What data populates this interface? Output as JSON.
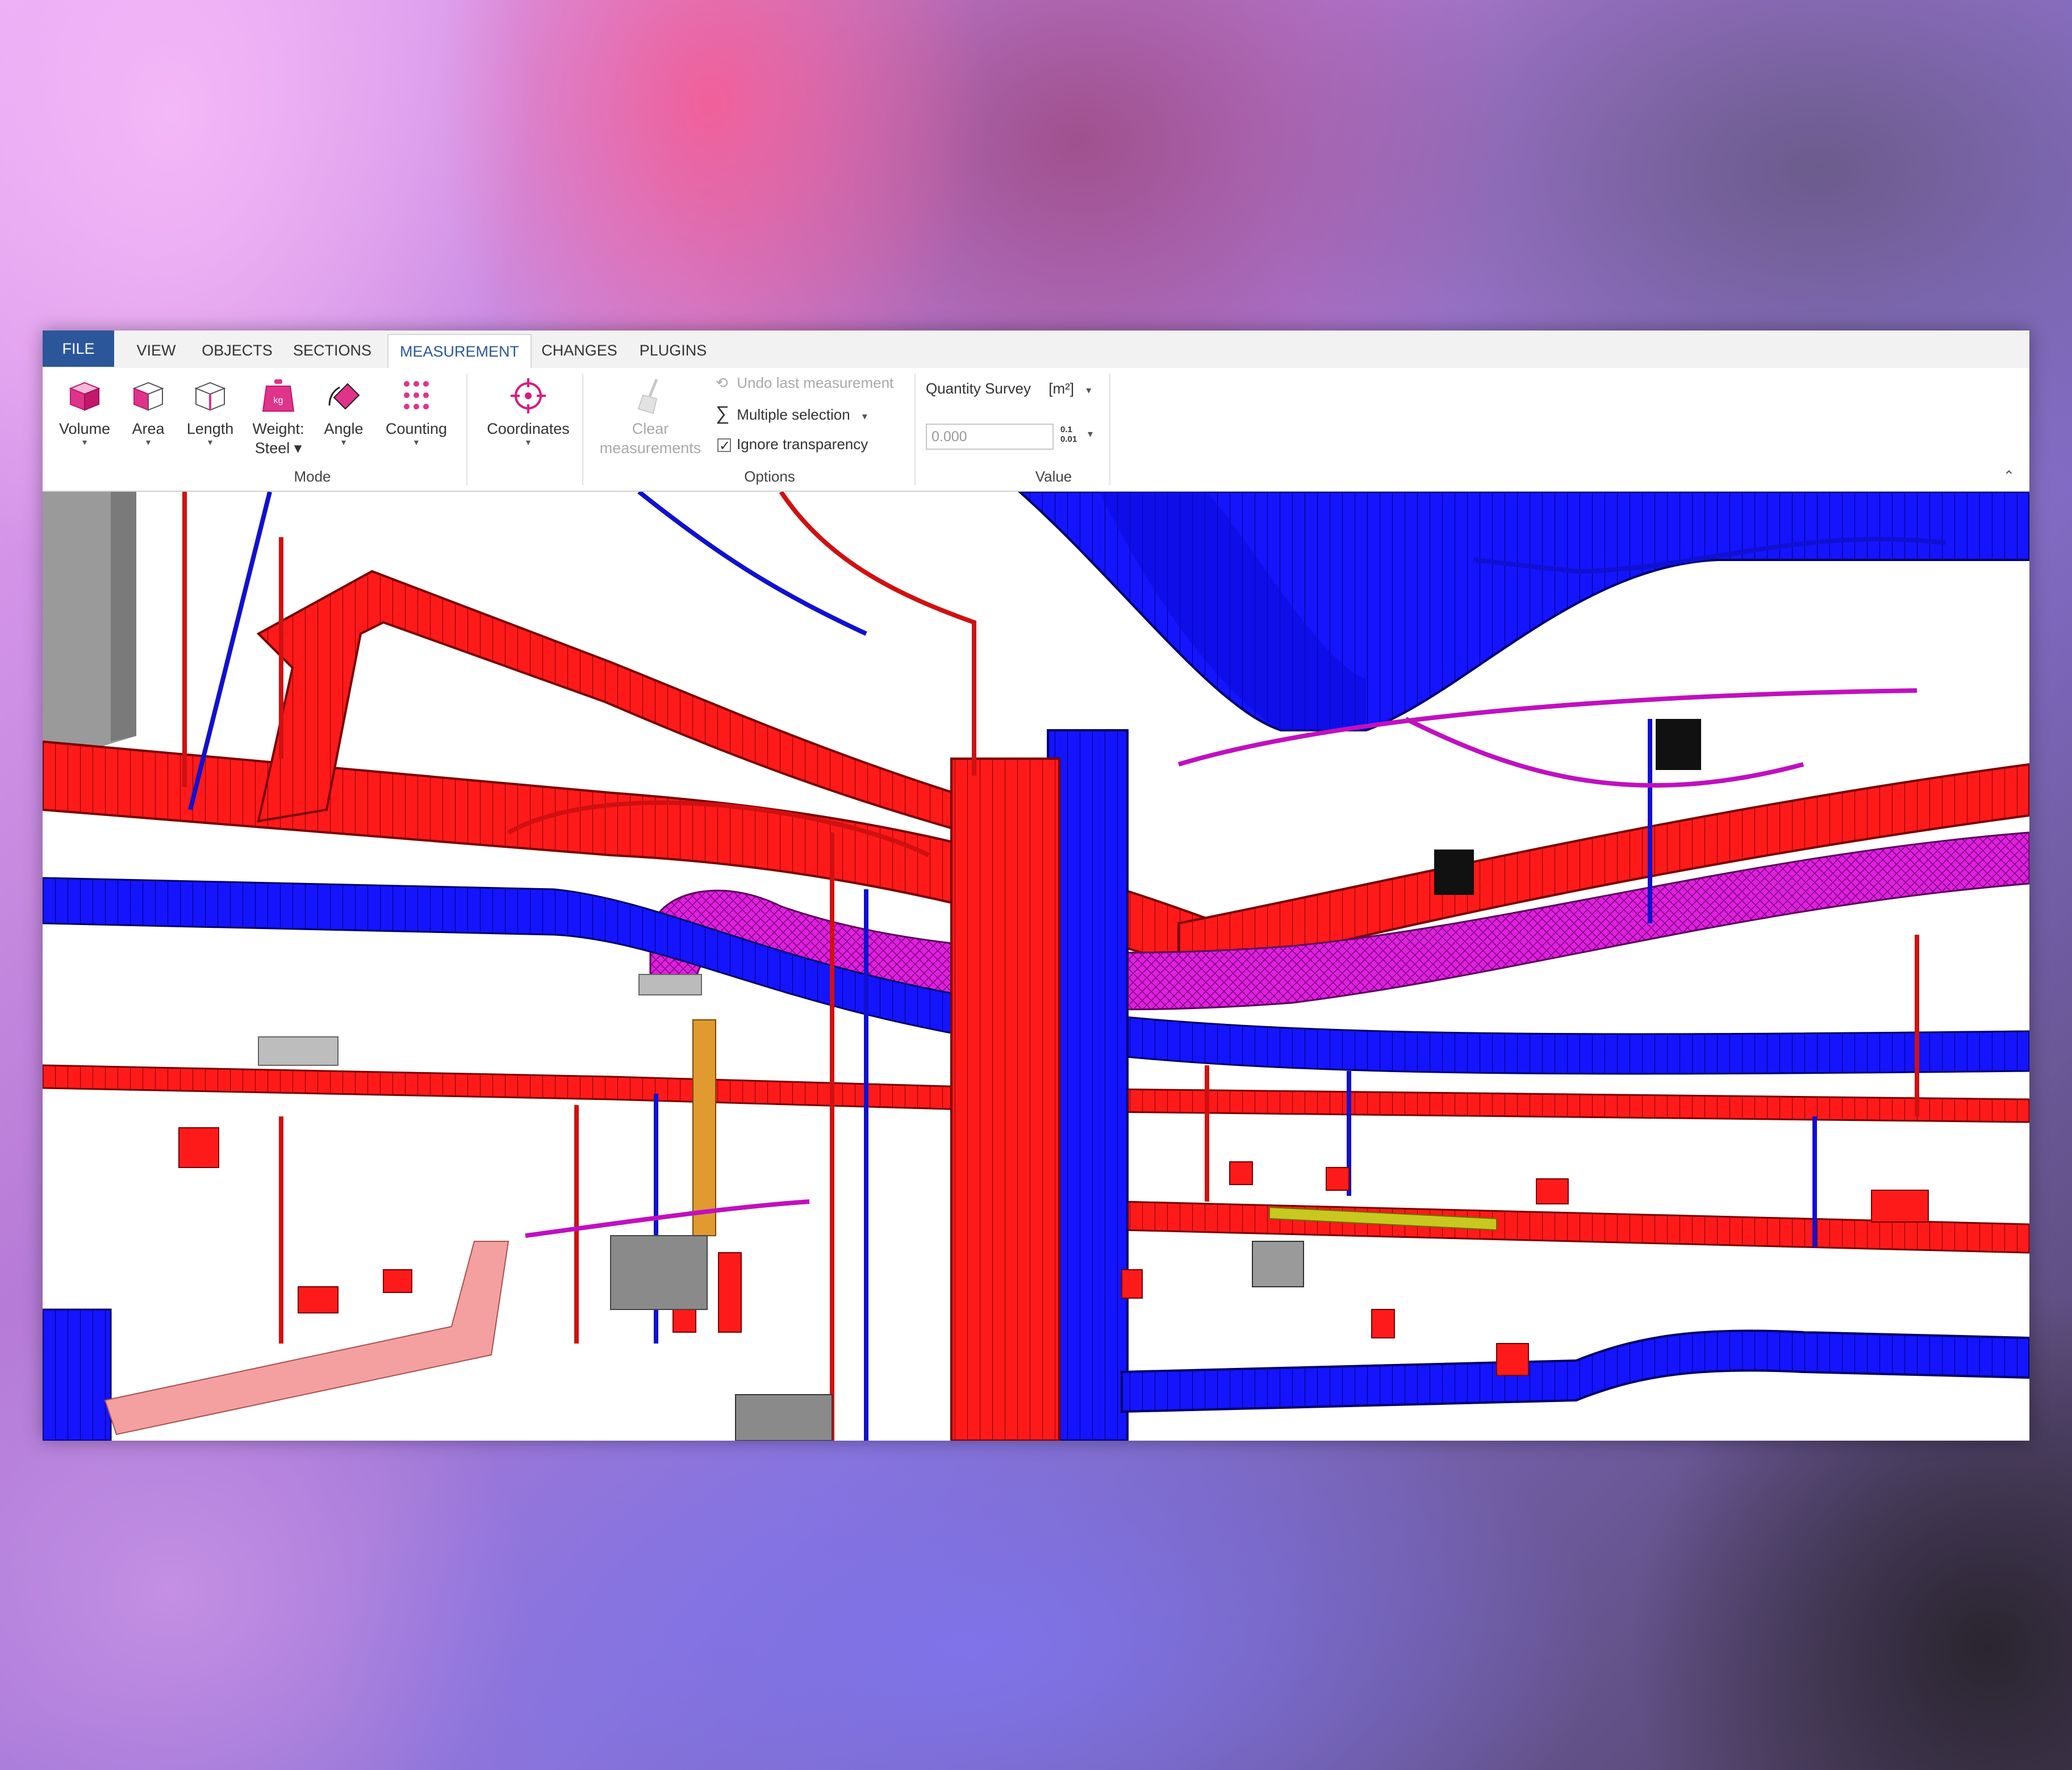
{
  "tabs": [
    {
      "label": "FILE"
    },
    {
      "label": "VIEW"
    },
    {
      "label": "OBJECTS"
    },
    {
      "label": "SECTIONS"
    },
    {
      "label": "MEASUREMENT"
    },
    {
      "label": "CHANGES"
    },
    {
      "label": "PLUGINS"
    }
  ],
  "active_tab": "MEASUREMENT",
  "mode_group": {
    "label": "Mode",
    "buttons": [
      {
        "label": "Volume",
        "icon": "volume-cube-icon"
      },
      {
        "label": "Area",
        "icon": "area-cube-icon"
      },
      {
        "label": "Length",
        "icon": "length-cube-icon"
      },
      {
        "label_line1": "Weight:",
        "label_line2": "Steel",
        "icon": "weight-kg-icon"
      },
      {
        "label": "Angle",
        "icon": "angle-icon"
      },
      {
        "label": "Counting",
        "icon": "counting-dots-icon"
      },
      {
        "label": "Coordinates",
        "icon": "crosshair-icon"
      }
    ]
  },
  "options_group": {
    "label": "Options",
    "clear_line1": "Clear",
    "clear_line2": "measurements",
    "undo_last": "Undo last measurement",
    "multiple_selection": "Multiple selection",
    "ignore_transparency": "Ignore transparency",
    "ignore_transparency_checked": true
  },
  "value_group": {
    "label": "Value",
    "quantity_survey": "Quantity Survey",
    "unit": "[m²]",
    "value": "0.000",
    "precision_icon_top": "0.1",
    "precision_icon_bottom": "0.01"
  },
  "colors": {
    "accent": "#d81b7a",
    "file_tab": "#2b579a",
    "duct_red": "#ff1a1a",
    "duct_blue": "#1a1aff",
    "duct_magenta": "#e01ee0",
    "duct_orange": "#e0a030",
    "duct_olive": "#c8c820"
  }
}
